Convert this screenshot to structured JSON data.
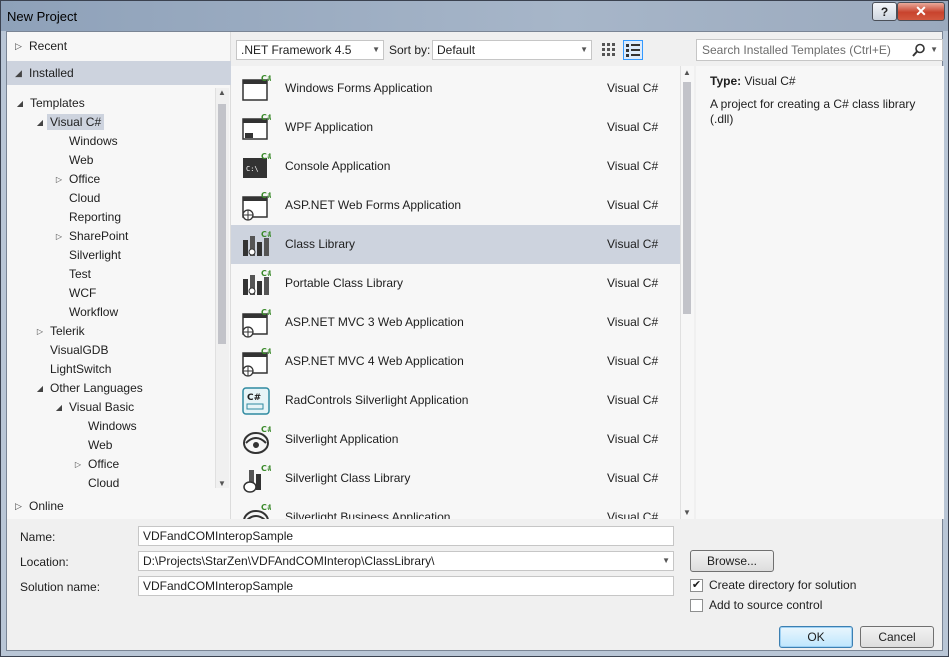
{
  "window": {
    "title": "New Project",
    "help_label": "?",
    "close_label": "✕"
  },
  "leftnav": {
    "recent": "Recent",
    "installed": "Installed",
    "online": "Online",
    "tree": [
      {
        "label": "Templates",
        "level": 1,
        "exp": "◢"
      },
      {
        "label": "Visual C#",
        "level": 2,
        "exp": "◢",
        "selected": true
      },
      {
        "label": "Windows",
        "level": 3,
        "exp": ""
      },
      {
        "label": "Web",
        "level": 3,
        "exp": ""
      },
      {
        "label": "Office",
        "level": 3,
        "exp": "▷"
      },
      {
        "label": "Cloud",
        "level": 3,
        "exp": ""
      },
      {
        "label": "Reporting",
        "level": 3,
        "exp": ""
      },
      {
        "label": "SharePoint",
        "level": 3,
        "exp": "▷"
      },
      {
        "label": "Silverlight",
        "level": 3,
        "exp": ""
      },
      {
        "label": "Test",
        "level": 3,
        "exp": ""
      },
      {
        "label": "WCF",
        "level": 3,
        "exp": ""
      },
      {
        "label": "Workflow",
        "level": 3,
        "exp": ""
      },
      {
        "label": "Telerik",
        "level": 2,
        "exp": "▷"
      },
      {
        "label": "VisualGDB",
        "level": 2,
        "exp": ""
      },
      {
        "label": "LightSwitch",
        "level": 2,
        "exp": ""
      },
      {
        "label": "Other Languages",
        "level": 2,
        "exp": "◢"
      },
      {
        "label": "Visual Basic",
        "level": 3,
        "exp": "◢"
      },
      {
        "label": "Windows",
        "level": 4,
        "exp": ""
      },
      {
        "label": "Web",
        "level": 4,
        "exp": ""
      },
      {
        "label": "Office",
        "level": 4,
        "exp": "▷"
      },
      {
        "label": "Cloud",
        "level": 4,
        "exp": ""
      }
    ]
  },
  "toolbar": {
    "framework": ".NET Framework 4.5",
    "sort_label": "Sort by:",
    "sort_value": "Default",
    "search_placeholder": "Search Installed Templates (Ctrl+E)"
  },
  "templates": [
    {
      "name": "Windows Forms Application",
      "lang": "Visual C#",
      "icon": "windows-forms-icon"
    },
    {
      "name": "WPF Application",
      "lang": "Visual C#",
      "icon": "wpf-icon"
    },
    {
      "name": "Console Application",
      "lang": "Visual C#",
      "icon": "console-icon"
    },
    {
      "name": "ASP.NET Web Forms Application",
      "lang": "Visual C#",
      "icon": "web-forms-icon"
    },
    {
      "name": "Class Library",
      "lang": "Visual C#",
      "icon": "class-library-icon",
      "selected": true
    },
    {
      "name": "Portable Class Library",
      "lang": "Visual C#",
      "icon": "portable-class-library-icon"
    },
    {
      "name": "ASP.NET MVC 3 Web Application",
      "lang": "Visual C#",
      "icon": "mvc3-icon"
    },
    {
      "name": "ASP.NET MVC 4 Web Application",
      "lang": "Visual C#",
      "icon": "mvc4-icon"
    },
    {
      "name": "RadControls Silverlight Application",
      "lang": "Visual C#",
      "icon": "radcontrols-icon"
    },
    {
      "name": "Silverlight Application",
      "lang": "Visual C#",
      "icon": "silverlight-icon"
    },
    {
      "name": "Silverlight Class Library",
      "lang": "Visual C#",
      "icon": "silverlight-class-library-icon"
    },
    {
      "name": "Silverlight Business Application",
      "lang": "Visual C#",
      "icon": "silverlight-business-icon"
    }
  ],
  "detail": {
    "type_label": "Type:",
    "type_value": "Visual C#",
    "description": "A project for creating a C# class library (.dll)"
  },
  "form": {
    "name_label": "Name:",
    "name_value": "VDFandCOMInteropSample",
    "location_label": "Location:",
    "location_value": "D:\\Projects\\StarZen\\VDFAndCOMInterop\\ClassLibrary\\",
    "solution_label": "Solution name:",
    "solution_value": "VDFandCOMInteropSample",
    "browse_label": "Browse...",
    "create_dir_label": "Create directory for solution",
    "create_dir_checked": true,
    "add_source_label": "Add to source control",
    "add_source_checked": false,
    "ok_label": "OK",
    "cancel_label": "Cancel"
  }
}
